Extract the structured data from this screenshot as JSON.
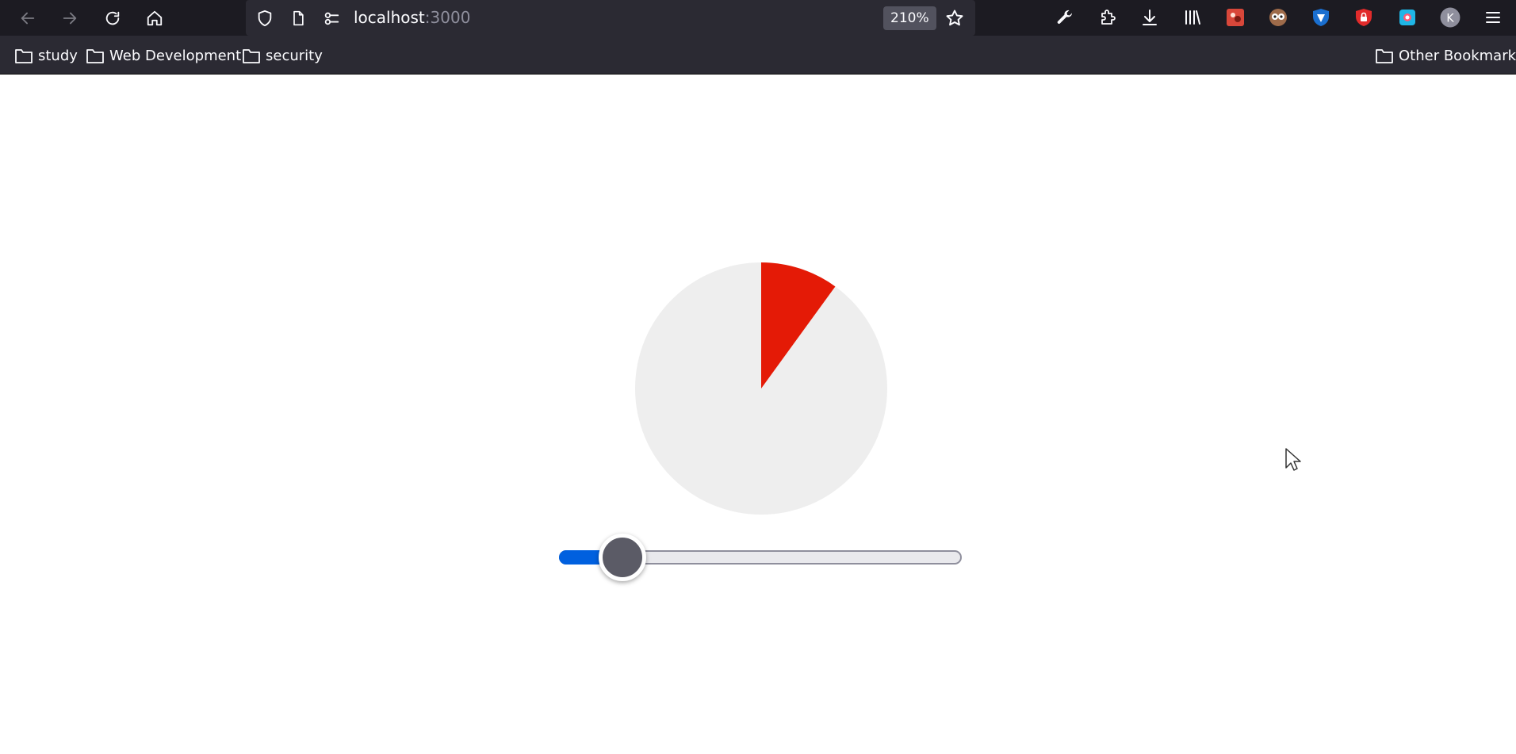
{
  "browser": {
    "url_host": "localhost",
    "url_port": ":3000",
    "zoom": "210%",
    "nav_icons": [
      "back-icon",
      "forward-icon",
      "reload-icon",
      "home-icon"
    ],
    "urlbar_icons": [
      "tracking-protection-shield-icon",
      "page-info-icon",
      "permissions-icon",
      "bookmark-star-icon"
    ],
    "toolbar_icons": [
      "wrench-icon",
      "extensions-icon",
      "downloads-icon",
      "library-icon",
      "extension-red-icon",
      "extension-owl-icon",
      "extension-shield-blue-icon",
      "extension-lock-red-icon",
      "extension-blue-square-icon",
      "account-avatar-icon",
      "menu-icon"
    ],
    "account_initial": "K"
  },
  "bookmarks": {
    "items": [
      {
        "label": "study",
        "icon": "folder-icon"
      },
      {
        "label": "Web Development",
        "icon": "folder-icon"
      },
      {
        "label": "security",
        "icon": "folder-icon"
      }
    ],
    "other": {
      "label": "Other Bookmarks",
      "icon": "folder-icon"
    }
  },
  "page": {
    "pie": {
      "percent": 10,
      "filled_color": "#e41a06",
      "empty_color": "#eeeeee"
    },
    "slider": {
      "min": 0,
      "max": 100,
      "value": 10,
      "fill_color": "#0060df",
      "thumb_color": "#5b5b66"
    }
  }
}
